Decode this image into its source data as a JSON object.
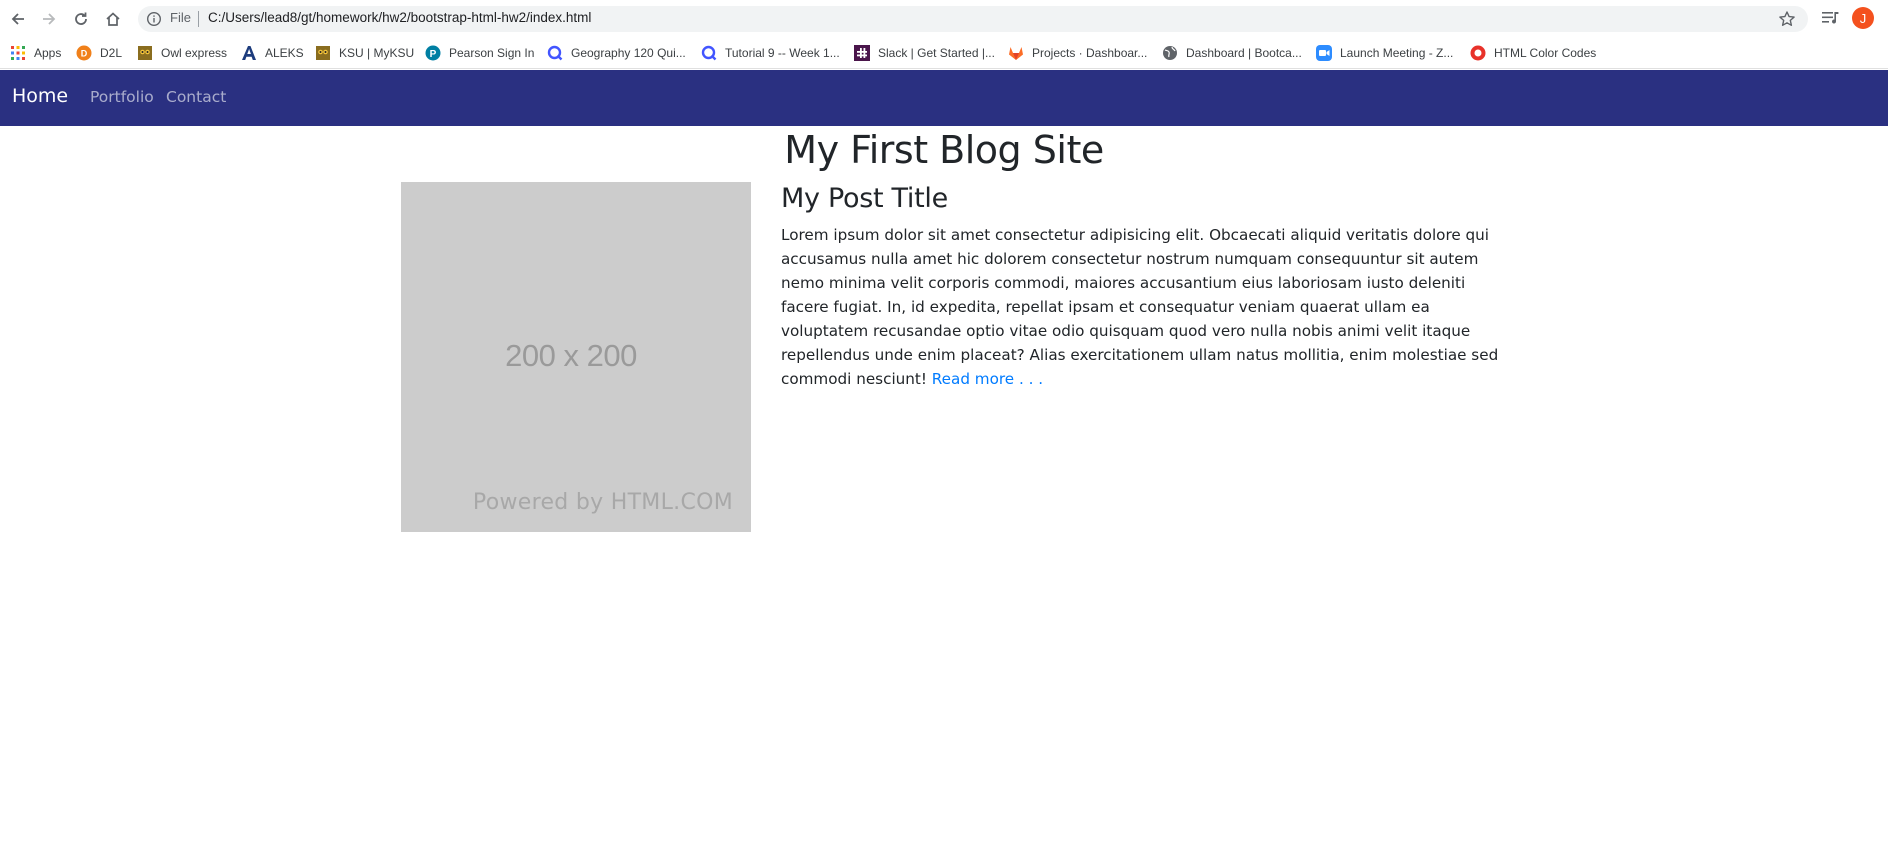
{
  "browser": {
    "file_label": "File",
    "url": "C:/Users/lead8/gt/homework/hw2/bootstrap-html-hw2/index.html",
    "avatar_letter": "J",
    "bookmarks": [
      {
        "label": "Apps",
        "icon": "apps-grid-icon"
      },
      {
        "label": "D2L",
        "icon": "d2l-icon"
      },
      {
        "label": "Owl express",
        "icon": "owl-icon"
      },
      {
        "label": "ALEKS",
        "icon": "aleks-icon"
      },
      {
        "label": "KSU | MyKSU",
        "icon": "owl-icon"
      },
      {
        "label": "Pearson Sign In",
        "icon": "pearson-icon"
      },
      {
        "label": "Geography 120 Qui...",
        "icon": "quizlet-icon"
      },
      {
        "label": "Tutorial 9 -- Week 1...",
        "icon": "quizlet-icon"
      },
      {
        "label": "Slack | Get Started |...",
        "icon": "slack-icon"
      },
      {
        "label": "Projects · Dashboar...",
        "icon": "gitlab-icon"
      },
      {
        "label": "Dashboard | Bootca...",
        "icon": "globe-icon"
      },
      {
        "label": "Launch Meeting - Z...",
        "icon": "zoom-icon"
      },
      {
        "label": "HTML Color Codes",
        "icon": "color-codes-icon"
      }
    ]
  },
  "navbar": {
    "brand": "Home",
    "links": [
      "Portfolio",
      "Contact"
    ],
    "background": "#2a3081"
  },
  "main": {
    "title": "My First Blog Site",
    "placeholder": {
      "size_text": "200 x 200",
      "powered_text": "Powered by HTML.COM"
    },
    "post": {
      "title": "My Post Title",
      "body": "Lorem ipsum dolor sit amet consectetur adipisicing elit. Obcaecati aliquid veritatis dolore qui accusamus nulla amet hic dolorem consectetur nostrum numquam consequuntur sit autem nemo minima velit corporis commodi, maiores accusantium eius laboriosam iusto deleniti facere fugiat. In, id expedita, repellat ipsam et consequatur veniam quaerat ullam ea voluptatem recusandae optio vitae odio quisquam quod vero nulla nobis animi velit itaque repellendus unde enim placeat? Alias exercitationem ullam natus mollitia, enim molestiae sed commodi nesciunt!",
      "read_more": "Read more . . ."
    }
  }
}
